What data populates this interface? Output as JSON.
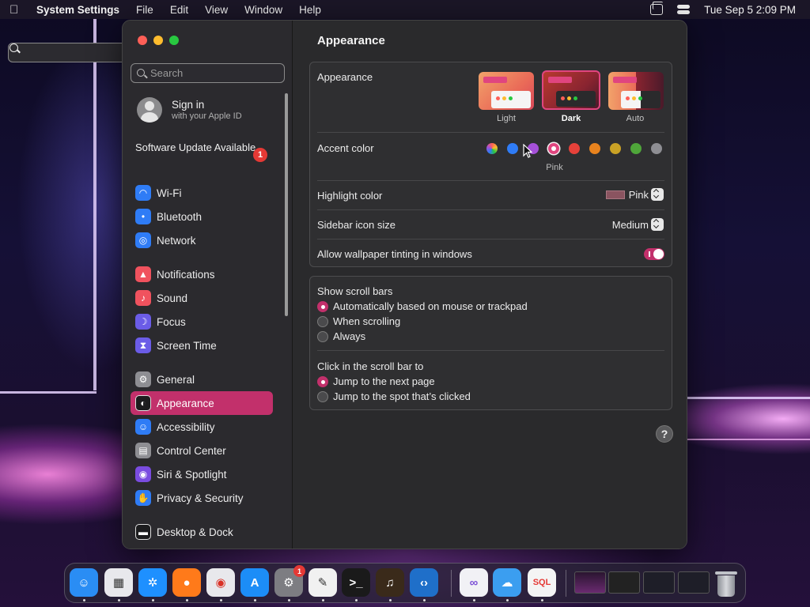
{
  "menubar": {
    "app_name": "System Settings",
    "menus": [
      "File",
      "Edit",
      "View",
      "Window",
      "Help"
    ],
    "clock": "Tue Sep 5  2:09 PM"
  },
  "sidebar": {
    "search_placeholder": "Search",
    "signin_title": "Sign in",
    "signin_sub": "with your Apple ID",
    "update_label": "Software Update Available",
    "update_badge": "1",
    "items": [
      {
        "label": "Wi-Fi",
        "icon": "wifi-icon",
        "color": "#2f7cf6"
      },
      {
        "label": "Bluetooth",
        "icon": "bluetooth-icon",
        "color": "#2f7cf6"
      },
      {
        "label": "Network",
        "icon": "globe-icon",
        "color": "#2f7cf6"
      },
      {
        "label": "Notifications",
        "icon": "bell-icon",
        "color": "#f0525e"
      },
      {
        "label": "Sound",
        "icon": "speaker-icon",
        "color": "#f0525e"
      },
      {
        "label": "Focus",
        "icon": "moon-icon",
        "color": "#6b5ce7"
      },
      {
        "label": "Screen Time",
        "icon": "hourglass-icon",
        "color": "#6b5ce7"
      },
      {
        "label": "General",
        "icon": "gear-icon",
        "color": "#8e8e93"
      },
      {
        "label": "Appearance",
        "icon": "appearance-icon",
        "color": "#1c1c1e"
      },
      {
        "label": "Accessibility",
        "icon": "accessibility-icon",
        "color": "#2f7cf6"
      },
      {
        "label": "Control Center",
        "icon": "switches-icon",
        "color": "#8e8e93"
      },
      {
        "label": "Siri & Spotlight",
        "icon": "siri-icon",
        "color": "#7a4ce0"
      },
      {
        "label": "Privacy & Security",
        "icon": "hand-icon",
        "color": "#2f7cf6"
      },
      {
        "label": "Desktop & Dock",
        "icon": "dock-icon",
        "color": "#1c1c1e"
      }
    ]
  },
  "content": {
    "title": "Appearance",
    "appearance_label": "Appearance",
    "modes": [
      "Light",
      "Dark",
      "Auto"
    ],
    "selected_mode": "Dark",
    "accent_label": "Accent color",
    "accent_colors": [
      "#e0e0e0",
      "#2f7cf6",
      "#a550d8",
      "#e0457f",
      "#e6413a",
      "#e8831e",
      "#c9a125",
      "#4fa63a",
      "#8e8e93"
    ],
    "accent_selected_name": "Pink",
    "highlight_label": "Highlight color",
    "highlight_value": "Pink",
    "highlight_swatch": "#8a5460",
    "icon_size_label": "Sidebar icon size",
    "icon_size_value": "Medium",
    "tinting_label": "Allow wallpaper tinting in windows",
    "scroll_title": "Show scroll bars",
    "scroll_options": [
      "Automatically based on mouse or trackpad",
      "When scrolling",
      "Always"
    ],
    "click_title": "Click in the scroll bar to",
    "click_options": [
      "Jump to the next page",
      "Jump to the spot that’s clicked"
    ],
    "help": "?",
    "accent": "#c2306b"
  },
  "dock": {
    "apps": [
      {
        "name": "finder-icon",
        "color": "#2a8df4"
      },
      {
        "name": "launchpad-icon",
        "color": "#e8e8ec"
      },
      {
        "name": "safari-icon",
        "color": "#1e90ff"
      },
      {
        "name": "firefox-icon",
        "color": "#ff7a1a"
      },
      {
        "name": "chrome-icon",
        "color": "#e8e8ec"
      },
      {
        "name": "app-store-icon",
        "color": "#1c8df7"
      },
      {
        "name": "system-settings-icon",
        "color": "#7d7d82"
      },
      {
        "name": "textedit-icon",
        "color": "#f1f1f1"
      },
      {
        "name": "terminal-icon",
        "color": "#1a1a1a"
      },
      {
        "name": "garageband-icon",
        "color": "#3a2a1a"
      },
      {
        "name": "vscode-icon",
        "color": "#1f6fc9"
      },
      {
        "name": "visual-studio-icon",
        "color": "#f1f1f5"
      },
      {
        "name": "weather-icon",
        "color": "#3b9ef0"
      },
      {
        "name": "sql-icon",
        "color": "#f4f4f4"
      }
    ],
    "settings_badge": "1",
    "sql_label": "SQL"
  }
}
